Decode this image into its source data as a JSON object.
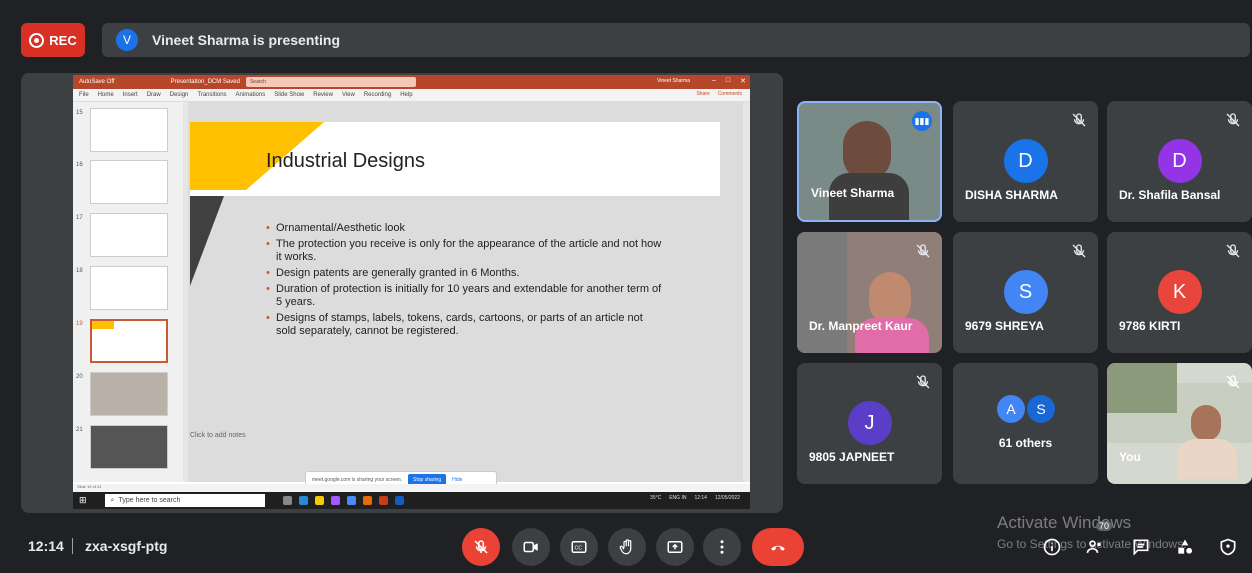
{
  "top": {
    "rec_label": "REC",
    "presenter_initial": "V",
    "presenting_text": "Vineet Sharma is presenting"
  },
  "ppt": {
    "title_bar": "AutoSave  Off",
    "file_name": "Presentation_DCM  Saved",
    "search_placeholder": "Search",
    "user": "Vineet Sharma",
    "menu": [
      "File",
      "Home",
      "Insert",
      "Draw",
      "Design",
      "Transitions",
      "Animations",
      "Slide Show",
      "Review",
      "View",
      "Recording",
      "Help"
    ],
    "share_label": "Share",
    "comments_label": "Comments",
    "thumb_numbers": [
      "15",
      "16",
      "17",
      "18",
      "19",
      "20",
      "21"
    ],
    "slide_title": "Industrial Designs",
    "bullets": [
      "Ornamental/Aesthetic look",
      "The protection you receive is only for the appearance of the article and not how it works.",
      "Design patents are generally granted in 6 Months.",
      "Duration of protection is initially for 10 years and extendable for another term of 5 years.",
      "Designs of stamps, labels, tokens, cards, cartoons, or parts of an article not sold separately, cannot be registered."
    ],
    "notes_placeholder": "Click to add notes",
    "share_toast_text": "meet.google.com is sharing your screen.",
    "stop_sharing_label": "Stop sharing",
    "hide_label": "Hide",
    "status_text": "Slide 19 of 41",
    "taskbar_search": "Type here to search",
    "weather": "35°C",
    "lang": "ENG IN",
    "time": "12:14",
    "date": "12/05/2022"
  },
  "tiles": [
    {
      "name": "Vineet Sharma",
      "type": "video",
      "speaking": true
    },
    {
      "name": "DISHA SHARMA",
      "initial": "D",
      "color": "#1a73e8"
    },
    {
      "name": "Dr. Shafila Bansal",
      "initial": "D",
      "color": "#9334e6"
    },
    {
      "name": "Dr. Manpreet Kaur",
      "type": "video"
    },
    {
      "name": "9679 SHREYA",
      "initial": "S",
      "color": "#4285f4"
    },
    {
      "name": "9786 KIRTI",
      "initial": "K",
      "color": "#e8453c"
    },
    {
      "name": "9805 JAPNEET",
      "initial": "J",
      "color": "#5b3ec8"
    },
    {
      "name": "61 others",
      "initials": [
        "A",
        "S"
      ]
    },
    {
      "name": "You",
      "type": "video"
    }
  ],
  "bottom": {
    "time": "12:14",
    "meeting_code": "zxa-xsgf-ptg",
    "participants_count": "70",
    "activate_title": "Activate Windows",
    "activate_sub": "Go to Settings to activate Windows."
  }
}
